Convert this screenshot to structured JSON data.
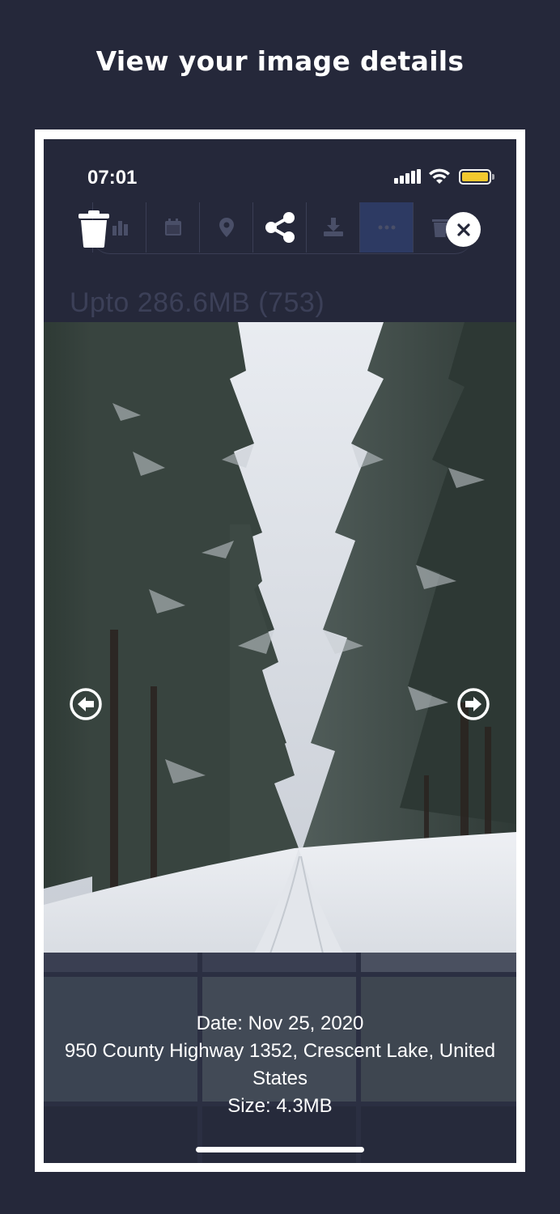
{
  "headline": "View your image details",
  "status_bar": {
    "time": "07:01"
  },
  "toolbar": {
    "icons": [
      "trash-icon",
      "bar-chart-icon",
      "calendar-icon",
      "location-pin-icon",
      "share-icon",
      "download-icon",
      "more-icon",
      "trash-icon"
    ]
  },
  "storage": {
    "text": "Upto 286.6MB (753)"
  },
  "photo": {
    "alt": "Snowy forest road"
  },
  "details": {
    "date": "Date: Nov 25, 2020",
    "address_line1": "950 County Highway 1352, Crescent Lake, United",
    "address_line2": "States",
    "size": "Size: 4.3MB"
  },
  "colors": {
    "background": "#25283a",
    "accent": "#2d3a63",
    "battery": "#ffd22e"
  }
}
